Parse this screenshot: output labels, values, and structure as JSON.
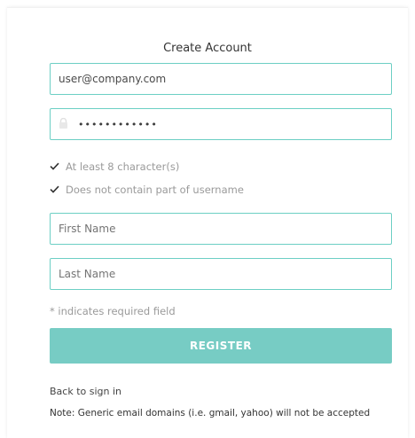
{
  "title": "Create Account",
  "fields": {
    "email_value": "user@company.com",
    "password_mask": "••••••••••••",
    "first_name_placeholder": "First Name",
    "last_name_placeholder": "Last Name"
  },
  "rules": [
    {
      "label": "At least 8 character(s)",
      "met": true
    },
    {
      "label": "Does not contain part of username",
      "met": true
    }
  ],
  "required_note": "* indicates required field",
  "register_label": "REGISTER",
  "back_link": "Back to sign in",
  "note": "Note: Generic email domains (i.e. gmail, yahoo) will not be accepted",
  "colors": {
    "accent": "#6ccfc4",
    "button": "#77ccc4",
    "muted_text": "#9a9a9a"
  }
}
